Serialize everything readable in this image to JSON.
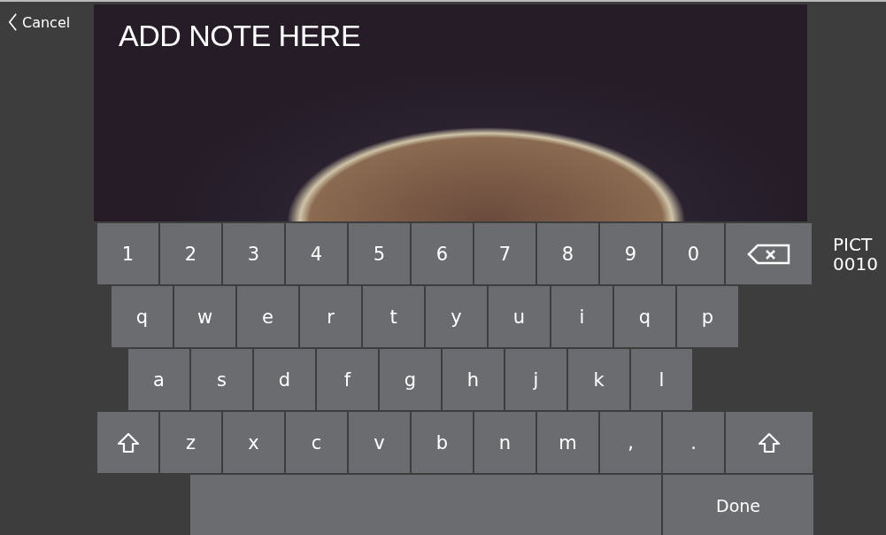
{
  "cancel_button": {
    "label": "Cancel"
  },
  "note_text": "ADD NOTE HERE",
  "file_label": [
    "PICT",
    "0010"
  ],
  "keyboard": {
    "rows": [
      {
        "keys": [
          {
            "kind": "char",
            "label": "1"
          },
          {
            "kind": "char",
            "label": "2"
          },
          {
            "kind": "char",
            "label": "3"
          },
          {
            "kind": "char",
            "label": "4"
          },
          {
            "kind": "char",
            "label": "5"
          },
          {
            "kind": "char",
            "label": "6"
          },
          {
            "kind": "char",
            "label": "7"
          },
          {
            "kind": "char",
            "label": "8"
          },
          {
            "kind": "char",
            "label": "9"
          },
          {
            "kind": "char",
            "label": "0"
          },
          {
            "kind": "backspace"
          }
        ]
      },
      {
        "keys": [
          {
            "kind": "char",
            "label": "q"
          },
          {
            "kind": "char",
            "label": "w"
          },
          {
            "kind": "char",
            "label": "e"
          },
          {
            "kind": "char",
            "label": "r"
          },
          {
            "kind": "char",
            "label": "t"
          },
          {
            "kind": "char",
            "label": "y"
          },
          {
            "kind": "char",
            "label": "u"
          },
          {
            "kind": "char",
            "label": "i"
          },
          {
            "kind": "char",
            "label": "q"
          },
          {
            "kind": "char",
            "label": "p"
          }
        ]
      },
      {
        "keys": [
          {
            "kind": "char",
            "label": "a"
          },
          {
            "kind": "char",
            "label": "s"
          },
          {
            "kind": "char",
            "label": "d"
          },
          {
            "kind": "char",
            "label": "f"
          },
          {
            "kind": "char",
            "label": "g"
          },
          {
            "kind": "char",
            "label": "h"
          },
          {
            "kind": "char",
            "label": "j"
          },
          {
            "kind": "char",
            "label": "k"
          },
          {
            "kind": "char",
            "label": "l"
          }
        ]
      },
      {
        "keys": [
          {
            "kind": "shift"
          },
          {
            "kind": "char",
            "label": "z"
          },
          {
            "kind": "char",
            "label": "x"
          },
          {
            "kind": "char",
            "label": "c"
          },
          {
            "kind": "char",
            "label": "v"
          },
          {
            "kind": "char",
            "label": "b"
          },
          {
            "kind": "char",
            "label": "n"
          },
          {
            "kind": "char",
            "label": "m"
          },
          {
            "kind": "char",
            "label": ","
          },
          {
            "kind": "char",
            "label": "."
          },
          {
            "kind": "shift"
          }
        ]
      },
      {
        "keys": [
          {
            "kind": "space"
          },
          {
            "kind": "done",
            "label": "Done"
          }
        ]
      }
    ]
  }
}
